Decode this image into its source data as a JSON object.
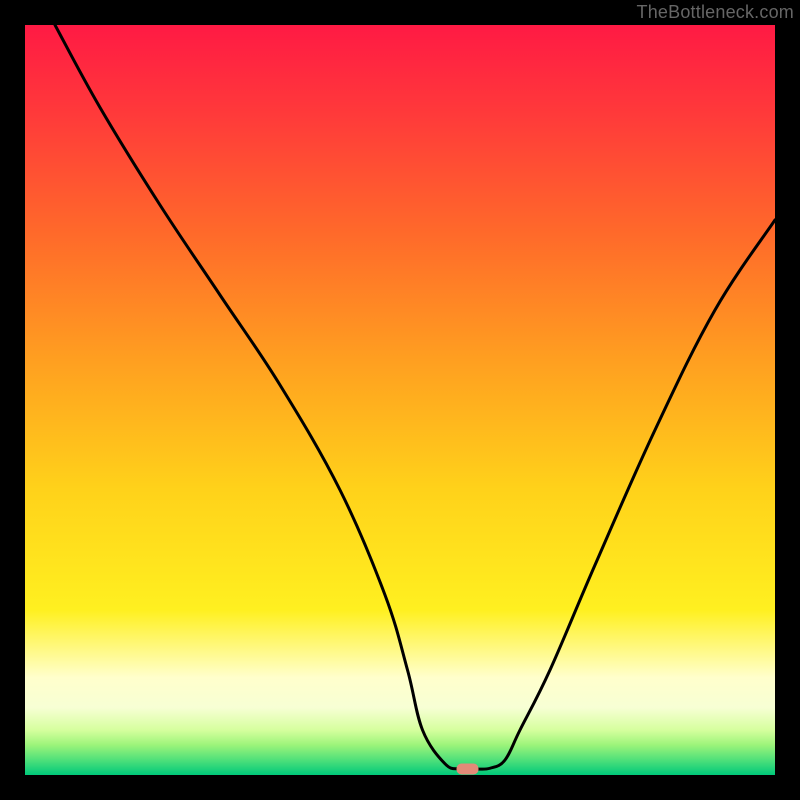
{
  "watermark": "TheBottleneck.com",
  "chart_data": {
    "type": "line",
    "title": "",
    "xlabel": "",
    "ylabel": "",
    "xlim": [
      0,
      100
    ],
    "ylim": [
      0,
      100
    ],
    "series": [
      {
        "name": "bottleneck-curve",
        "x": [
          4,
          10,
          18,
          26,
          34,
          42,
          48,
          51,
          53,
          56,
          58,
          60,
          62,
          64,
          66,
          70,
          76,
          84,
          92,
          100
        ],
        "y": [
          100,
          89,
          76,
          64,
          52,
          38,
          24,
          14,
          6,
          1.5,
          0.8,
          0.8,
          0.9,
          2,
          6,
          14,
          28,
          46,
          62,
          74
        ]
      }
    ],
    "marker": {
      "x": 59,
      "y": 0.8,
      "color": "#e38a78"
    },
    "background_gradient": {
      "stops": [
        {
          "pos": 0.0,
          "color": "#ff1a44"
        },
        {
          "pos": 0.12,
          "color": "#ff3a3a"
        },
        {
          "pos": 0.28,
          "color": "#ff6a2a"
        },
        {
          "pos": 0.45,
          "color": "#ffa020"
        },
        {
          "pos": 0.62,
          "color": "#ffd21a"
        },
        {
          "pos": 0.78,
          "color": "#fff020"
        },
        {
          "pos": 0.87,
          "color": "#ffffcc"
        },
        {
          "pos": 0.91,
          "color": "#f7ffd4"
        },
        {
          "pos": 0.94,
          "color": "#d6ff9e"
        },
        {
          "pos": 0.96,
          "color": "#9cf47a"
        },
        {
          "pos": 0.98,
          "color": "#4fe07a"
        },
        {
          "pos": 1.0,
          "color": "#00c97a"
        }
      ]
    }
  }
}
